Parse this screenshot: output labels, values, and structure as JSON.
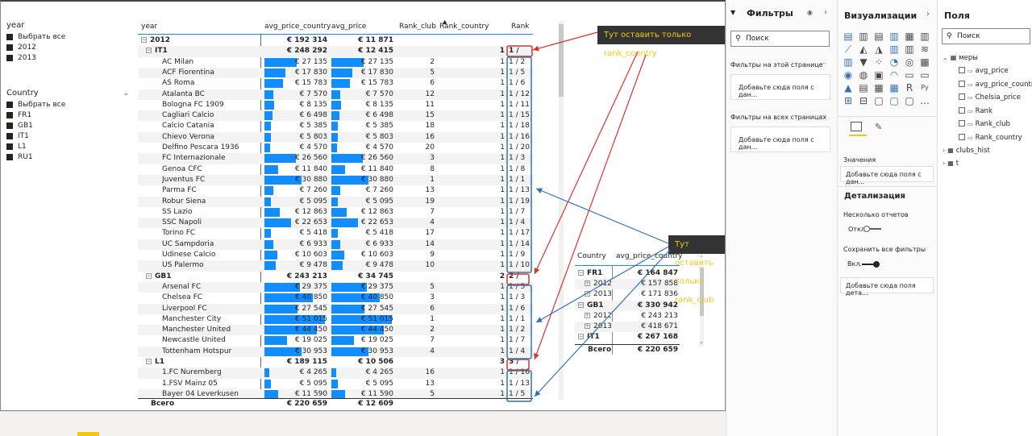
{
  "slicer_year": {
    "title": "year",
    "items": [
      "Выбрать все",
      "2012",
      "2013"
    ]
  },
  "slicer_country": {
    "title": "Country",
    "items": [
      "Выбрать все",
      "FR1",
      "GB1",
      "IT1",
      "L1",
      "RU1"
    ]
  },
  "matrix": {
    "headers": {
      "name": "year",
      "apc": "avg_price_country",
      "ap": "avg_price",
      "rc": "Rank_club",
      "rco": "Rank_country",
      "rk": "Rank"
    },
    "rows": [
      {
        "t": "g1",
        "name": "2012",
        "apc": "€ 192 314",
        "ap": "€ 11 871",
        "rc": "",
        "rco": "",
        "rk": ""
      },
      {
        "t": "g2",
        "name": "IT1",
        "apc": "€ 248 292",
        "ap": "€ 12 415",
        "rc": "",
        "rco": "1",
        "rk": "1 /"
      },
      {
        "t": "c",
        "name": "AC Milan",
        "apc": "€ 27 135",
        "ap": "€ 27 135",
        "rc": "2",
        "rco": "1",
        "rk": "1 / 2",
        "pct": 0.53
      },
      {
        "t": "c",
        "name": "ACF Fiorentina",
        "apc": "€ 17 830",
        "ap": "€ 17 830",
        "rc": "5",
        "rco": "1",
        "rk": "1 / 5",
        "pct": 0.35
      },
      {
        "t": "c",
        "name": "AS Roma",
        "apc": "€ 15 783",
        "ap": "€ 15 783",
        "rc": "6",
        "rco": "1",
        "rk": "1 / 6",
        "pct": 0.31
      },
      {
        "t": "c",
        "name": "Atalanta BC",
        "apc": "€ 7 570",
        "ap": "€ 7 570",
        "rc": "12",
        "rco": "1",
        "rk": "1 / 12",
        "pct": 0.15
      },
      {
        "t": "c",
        "name": "Bologna FC 1909",
        "apc": "€ 8 135",
        "ap": "€ 8 135",
        "rc": "11",
        "rco": "1",
        "rk": "1 / 11",
        "pct": 0.16
      },
      {
        "t": "c",
        "name": "Cagliari Calcio",
        "apc": "€ 6 498",
        "ap": "€ 6 498",
        "rc": "15",
        "rco": "1",
        "rk": "1 / 15",
        "pct": 0.13
      },
      {
        "t": "c",
        "name": "Calcio Catania",
        "apc": "€ 5 385",
        "ap": "€ 5 385",
        "rc": "18",
        "rco": "1",
        "rk": "1 / 18",
        "pct": 0.11
      },
      {
        "t": "c",
        "name": "Chievo Verona",
        "apc": "€ 5 803",
        "ap": "€ 5 803",
        "rc": "16",
        "rco": "1",
        "rk": "1 / 16",
        "pct": 0.11
      },
      {
        "t": "c",
        "name": "Delfino Pescara 1936",
        "apc": "€ 4 570",
        "ap": "€ 4 570",
        "rc": "20",
        "rco": "1",
        "rk": "1 / 20",
        "pct": 0.09
      },
      {
        "t": "c",
        "name": "FC Internazionale",
        "apc": "€ 26 560",
        "ap": "€ 26 560",
        "rc": "3",
        "rco": "1",
        "rk": "1 / 3",
        "pct": 0.52
      },
      {
        "t": "c",
        "name": "Genoa CFC",
        "apc": "€ 11 840",
        "ap": "€ 11 840",
        "rc": "8",
        "rco": "1",
        "rk": "1 / 8",
        "pct": 0.23
      },
      {
        "t": "c",
        "name": "Juventus FC",
        "apc": "€ 30 880",
        "ap": "€ 30 880",
        "rc": "1",
        "rco": "1",
        "rk": "1 / 1",
        "pct": 0.61
      },
      {
        "t": "c",
        "name": "Parma FC",
        "apc": "€ 7 260",
        "ap": "€ 7 260",
        "rc": "13",
        "rco": "1",
        "rk": "1 / 13",
        "pct": 0.14
      },
      {
        "t": "c",
        "name": "Robur Siena",
        "apc": "€ 5 095",
        "ap": "€ 5 095",
        "rc": "19",
        "rco": "1",
        "rk": "1 / 19",
        "pct": 0.1
      },
      {
        "t": "c",
        "name": "SS Lazio",
        "apc": "€ 12 863",
        "ap": "€ 12 863",
        "rc": "7",
        "rco": "1",
        "rk": "1 / 7",
        "pct": 0.25
      },
      {
        "t": "c",
        "name": "SSC Napoli",
        "apc": "€ 22 653",
        "ap": "€ 22 653",
        "rc": "4",
        "rco": "1",
        "rk": "1 / 4",
        "pct": 0.44
      },
      {
        "t": "c",
        "name": "Torino FC",
        "apc": "€ 5 418",
        "ap": "€ 5 418",
        "rc": "17",
        "rco": "1",
        "rk": "1 / 17",
        "pct": 0.11
      },
      {
        "t": "c",
        "name": "UC Sampdoria",
        "apc": "€ 6 933",
        "ap": "€ 6 933",
        "rc": "14",
        "rco": "1",
        "rk": "1 / 14",
        "pct": 0.14
      },
      {
        "t": "c",
        "name": "Udinese Calcio",
        "apc": "€ 10 603",
        "ap": "€ 10 603",
        "rc": "9",
        "rco": "1",
        "rk": "1 / 9",
        "pct": 0.21
      },
      {
        "t": "c",
        "name": "US Palermo",
        "apc": "€ 9 478",
        "ap": "€ 9 478",
        "rc": "10",
        "rco": "1",
        "rk": "1 / 10",
        "pct": 0.19
      },
      {
        "t": "g2",
        "name": "GB1",
        "apc": "€ 243 213",
        "ap": "€ 34 745",
        "rc": "",
        "rco": "2",
        "rk": "2 /"
      },
      {
        "t": "c",
        "name": "Arsenal FC",
        "apc": "€ 29 375",
        "ap": "€ 29 375",
        "rc": "5",
        "rco": "1",
        "rk": "1 / 5",
        "pct": 0.58
      },
      {
        "t": "c",
        "name": "Chelsea FC",
        "apc": "€ 40 850",
        "ap": "€ 40 850",
        "rc": "3",
        "rco": "1",
        "rk": "1 / 3",
        "pct": 0.8
      },
      {
        "t": "c",
        "name": "Liverpool FC",
        "apc": "€ 27 545",
        "ap": "€ 27 545",
        "rc": "6",
        "rco": "1",
        "rk": "1 / 6",
        "pct": 0.54
      },
      {
        "t": "c",
        "name": "Manchester City",
        "apc": "€ 51 015",
        "ap": "€ 51 015",
        "rc": "1",
        "rco": "1",
        "rk": "1 / 1",
        "pct": 1.0
      },
      {
        "t": "c",
        "name": "Manchester United",
        "apc": "€ 44 450",
        "ap": "€ 44 450",
        "rc": "2",
        "rco": "1",
        "rk": "1 / 2",
        "pct": 0.87
      },
      {
        "t": "c",
        "name": "Newcastle United",
        "apc": "€ 19 025",
        "ap": "€ 19 025",
        "rc": "7",
        "rco": "1",
        "rk": "1 / 7",
        "pct": 0.37
      },
      {
        "t": "c",
        "name": "Tottenham Hotspur",
        "apc": "€ 30 953",
        "ap": "€ 30 953",
        "rc": "4",
        "rco": "1",
        "rk": "1 / 4",
        "pct": 0.61
      },
      {
        "t": "g2",
        "name": "L1",
        "apc": "€ 189 115",
        "ap": "€ 10 506",
        "rc": "",
        "rco": "3",
        "rk": "3 /"
      },
      {
        "t": "c",
        "name": "1.FC Nuremberg",
        "apc": "€ 4 265",
        "ap": "€ 4 265",
        "rc": "16",
        "rco": "1",
        "rk": "1 / 16",
        "pct": 0.08
      },
      {
        "t": "c",
        "name": "1.FSV Mainz 05",
        "apc": "€ 5 095",
        "ap": "€ 5 095",
        "rc": "13",
        "rco": "1",
        "rk": "1 / 13",
        "pct": 0.1
      },
      {
        "t": "c",
        "name": "Bayer 04 Leverkusen",
        "apc": "€ 11 590",
        "ap": "€ 11 590",
        "rc": "5",
        "rco": "1",
        "rk": "1 / 5",
        "pct": 0.23
      }
    ],
    "total": {
      "name": "Всего",
      "apc": "€ 220 659",
      "ap": "€ 12 609"
    }
  },
  "matrix2": {
    "headers": {
      "country": "Country",
      "apc": "avg_price_country"
    },
    "rows": [
      {
        "t": "g",
        "name": "FR1",
        "apc": "€ 164 847"
      },
      {
        "t": "c",
        "name": "2012",
        "apc": "€ 157 858"
      },
      {
        "t": "c",
        "name": "2013",
        "apc": "€ 171 836"
      },
      {
        "t": "g",
        "name": "GB1",
        "apc": "€ 330 942"
      },
      {
        "t": "c",
        "name": "2012",
        "apc": "€ 243 213"
      },
      {
        "t": "c",
        "name": "2013",
        "apc": "€ 418 671"
      },
      {
        "t": "g",
        "name": "IT1",
        "apc": "€ 267 168"
      }
    ],
    "total": {
      "name": "Всего",
      "apc": "€ 220 659"
    }
  },
  "annotations": {
    "country_note": "Тут оставить только rank_country",
    "club_note": "Тут оставить только rank_club"
  },
  "filters_pane": {
    "title": "Фильтры",
    "search_placeholder": "Поиск",
    "on_page": "Фильтры на этой странице",
    "on_all_pages": "Фильтры на всех страницах",
    "drop_hint": "Добавьте сюда поля с дан..."
  },
  "viz_pane": {
    "title": "Визуализации",
    "values_label": "Значения",
    "values_drop": "Добавьте сюда поля с дан...",
    "drill_title": "Детализация",
    "multi_reports": "Несколько отчетов",
    "toggle_off": "Откл.",
    "keep_filters": "Сохранить все фильтры",
    "toggle_on": "Вкл.",
    "drill_drop": "Добавьте сюда поля дета..."
  },
  "fields_pane": {
    "title": "Поля",
    "search_placeholder": "Поиск",
    "tables": [
      {
        "name": "меры",
        "fields": [
          "avg_price",
          "avg_price_country",
          "Chelsia_price",
          "Rank",
          "Rank_club",
          "Rank_country"
        ]
      },
      {
        "name": "clubs_hist",
        "fields": []
      },
      {
        "name": "t",
        "fields": []
      }
    ]
  },
  "colors": {
    "bar": "#118dff",
    "annotation_bg": "#333333",
    "annotation_text": "#f2c811",
    "arrow_red": "#d9342b",
    "arrow_blue": "#2e75b6"
  }
}
